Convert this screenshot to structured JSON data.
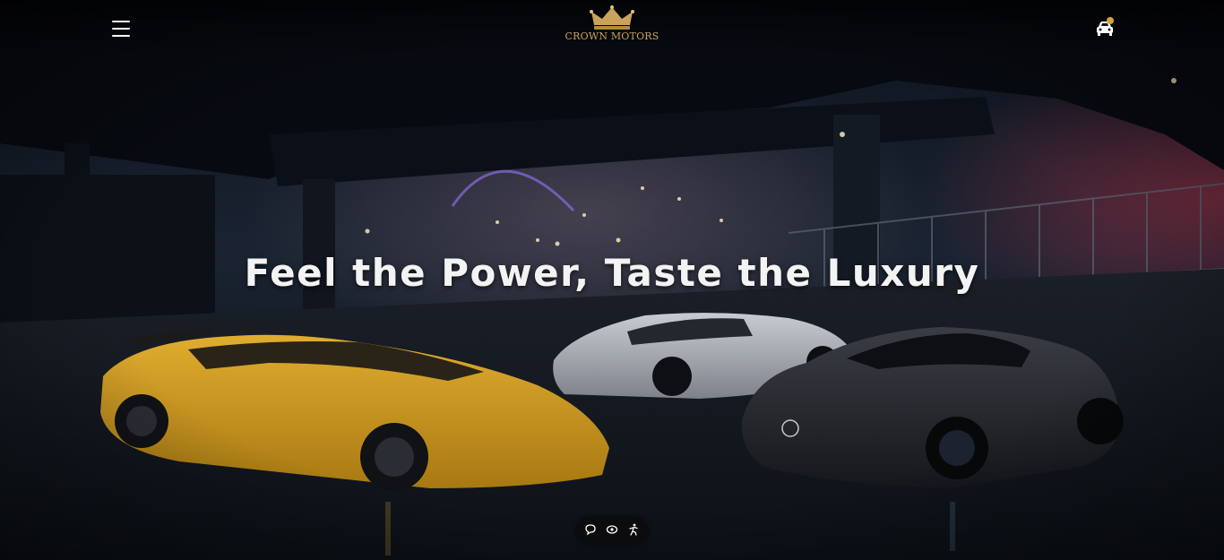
{
  "header": {
    "menu_icon": "hamburger-menu-icon",
    "logo_icon": "crown-icon",
    "brand_name": "CROWN MOTORS",
    "brand_color": "#c9a25b",
    "cart_icon": "car-cart-icon",
    "cart_badge_color": "#d4a43a"
  },
  "hero": {
    "headline": "Feel the Power, Taste the Luxury",
    "background": "night-underpass-three-supercars"
  },
  "floating_widget": {
    "icons": [
      "chat-icon",
      "eye-icon",
      "accessibility-icon"
    ]
  }
}
